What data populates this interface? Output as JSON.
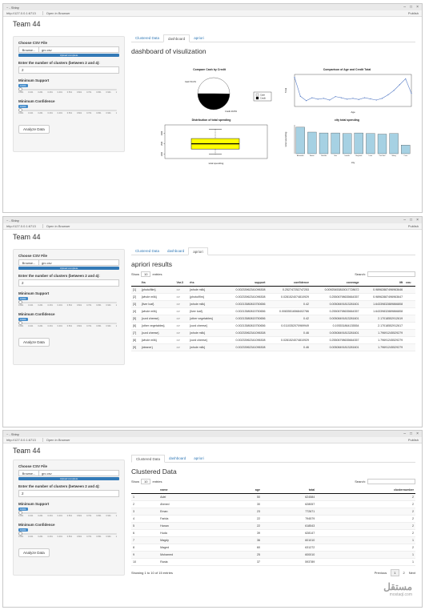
{
  "window": {
    "title": "~ - Shiny",
    "url": "http://127.0.0.1:6713",
    "open_browser": "Open in Browser",
    "publish": "Publish"
  },
  "app_title": "Team 44",
  "sidebar": {
    "csv_label": "Choose CSV File",
    "browse": "Browse...",
    "file_name": "grc.csv",
    "upload_status": "Upload complete",
    "clusters_label": "Enter the number of clusters (between 2 and 4):",
    "clusters_value": "2",
    "support_label": "Minimum Support",
    "support_value": "0.001",
    "confidence_label": "Minimum Confidence",
    "confidence_value": "0.001",
    "slider_ticks": [
      "0.001",
      "0.101",
      "0.201",
      "0.301",
      "0.401",
      "0.501",
      "0.601",
      "0.701",
      "0.801",
      "0.901",
      "1"
    ],
    "analyze": "Analyze Data"
  },
  "tabs": [
    "Clustered Data",
    "dashboard",
    "apriori"
  ],
  "dashboard": {
    "heading": "dashboard of visulization",
    "pie": {
      "title": "Compare Cash by Credit",
      "legend": [
        "Cash",
        "Credit"
      ],
      "labels": [
        "Cash 50.2%",
        "Credit 49.8%"
      ]
    },
    "line": {
      "title": "Comparison of Age and Credit Total",
      "xlabel": "Age",
      "ylabel": "Total"
    },
    "box": {
      "title": "Distribution of total spending",
      "xlabel": "total spending"
    },
    "bar": {
      "title": "city total spending",
      "xlabel": "city",
      "ylabel": "total spending"
    }
  },
  "chart_data": [
    {
      "type": "pie",
      "title": "Compare Cash by Credit",
      "slices": [
        {
          "label": "Cash",
          "value": 50.2
        },
        {
          "label": "Credit",
          "value": 49.8
        }
      ],
      "colors": [
        "#ffffff",
        "#000000"
      ],
      "legend": "right"
    },
    {
      "type": "line",
      "title": "Comparison of Age and Credit Total",
      "xlabel": "Age",
      "ylabel": "Total",
      "x": [
        20,
        22,
        24,
        26,
        28,
        30,
        32,
        34,
        36,
        38,
        40,
        42,
        44,
        46,
        48,
        50,
        52,
        54,
        56,
        58,
        60
      ],
      "values": [
        100,
        35,
        20,
        30,
        25,
        28,
        22,
        34,
        30,
        25,
        28,
        24,
        30,
        26,
        22,
        28,
        40,
        55,
        75,
        95,
        45
      ],
      "ylim": [
        0,
        110
      ]
    },
    {
      "type": "box",
      "title": "Distribution of total spending",
      "xlabel": "total spending",
      "min": 1000,
      "q1": 1250,
      "median": 1500,
      "q3": 1750,
      "max": 2200,
      "ylim": [
        800,
        2400
      ],
      "fill": "#ffff00"
    },
    {
      "type": "bar",
      "title": "city total spending",
      "xlabel": "city",
      "ylabel": "total spending",
      "categories": [
        "Alexandria",
        "Aswan",
        "Dakahlia",
        "Giza",
        "Ismailia",
        "Hurghada",
        "Luxor",
        "Port Said",
        "Sohag",
        "Cairo"
      ],
      "values": [
        92,
        75,
        72,
        72,
        70,
        72,
        70,
        68,
        70,
        30
      ],
      "ylim": [
        0,
        100
      ],
      "color": "#a6d1e3"
    }
  ],
  "apriori": {
    "heading": "apriori results",
    "show": "Show",
    "page_len": "10",
    "entries": "entries",
    "search": "Search:",
    "columns": [
      "",
      "lhs",
      "Var.3",
      "rhs",
      "support",
      "confidence",
      "coverage",
      "lift",
      "cou"
    ],
    "rows": [
      [
        "[1]",
        "{photo/film}",
        "=>",
        "{whole milk}",
        "0.00233962341096308",
        "0.252747252747253",
        "0.00925453815017728672",
        "0.98962887496963646",
        ""
      ],
      [
        "[2]",
        "{whole milk}",
        "=>",
        "{photo/film}",
        "0.00233962341096308",
        "0.0281524074810929",
        "0.25506798635664357",
        "0.98962887496963647",
        ""
      ],
      [
        "[3]",
        "{liver loaf}",
        "=>",
        "{whole milk}",
        "0.00213580815750656",
        "0.42",
        "0.00508491813281601",
        "1.64339832889866808",
        ""
      ],
      [
        "[4]",
        "{whole milk}",
        "=>",
        "{liver loaf}",
        "0.00213580815750656",
        "0.00835516568402786",
        "0.25506798635664357",
        "1.64339832889866808",
        ""
      ],
      [
        "[5]",
        "{curd cheese}",
        "=>",
        "{other vegetables}",
        "0.00213580815750656",
        "0.42",
        "0.00508491813281601",
        "2.17018552912619",
        ""
      ],
      [
        "[6]",
        "{other vegetables}",
        "=>",
        "{curd cheese}",
        "0.00213580815750656",
        "0.0110352070969949",
        "0.193531864135554",
        "2.17018552912617",
        ""
      ],
      [
        "[7]",
        "{curd cheese}",
        "=>",
        "{whole milk}",
        "0.00233962341096308",
        "0.46",
        "0.00508491813281601",
        "1.79691245529279",
        ""
      ],
      [
        "[8]",
        "{whole milk}",
        "=>",
        "{curd cheese}",
        "0.00233962341096308",
        "0.0281524074810929",
        "0.25506798635664357",
        "1.79691245529279",
        ""
      ],
      [
        "[9]",
        "{cleaner}",
        "=>",
        "{whole milk}",
        "0.00233962341096308",
        "0.46",
        "0.00508491813281601",
        "1.79691245529279",
        ""
      ]
    ]
  },
  "clustered": {
    "heading": "Clustered Data",
    "show": "Show",
    "page_len": "10",
    "entries": "entries",
    "search": "Search:",
    "columns": [
      "",
      "name",
      "age",
      "total",
      "clusternumber"
    ],
    "rows": [
      [
        "1",
        "Adel",
        "50",
        "624584",
        "2"
      ],
      [
        "2",
        "Ahmed",
        "30",
        "628057",
        "2"
      ],
      [
        "3",
        "Eman",
        "23",
        "772671",
        "2"
      ],
      [
        "4",
        "Farida",
        "22",
        "794579",
        "2"
      ],
      [
        "5",
        "Hanan",
        "22",
        "618543",
        "2"
      ],
      [
        "6",
        "Huda",
        "39",
        "628147",
        "2"
      ],
      [
        "7",
        "Magdy",
        "36",
        "601010",
        "1"
      ],
      [
        "8",
        "Maged",
        "60",
        "631272",
        "2"
      ],
      [
        "9",
        "Mohamed",
        "25",
        "600010",
        "1"
      ],
      [
        "10",
        "Rania",
        "37",
        "593789",
        "1"
      ]
    ],
    "info": "Showing 1 to 10 of 15 entries",
    "prev": "Previous",
    "pages": [
      "1",
      "2"
    ],
    "next": "Next"
  },
  "watermark": {
    "arabic": "مستقل",
    "latin": "mostaql.com"
  }
}
